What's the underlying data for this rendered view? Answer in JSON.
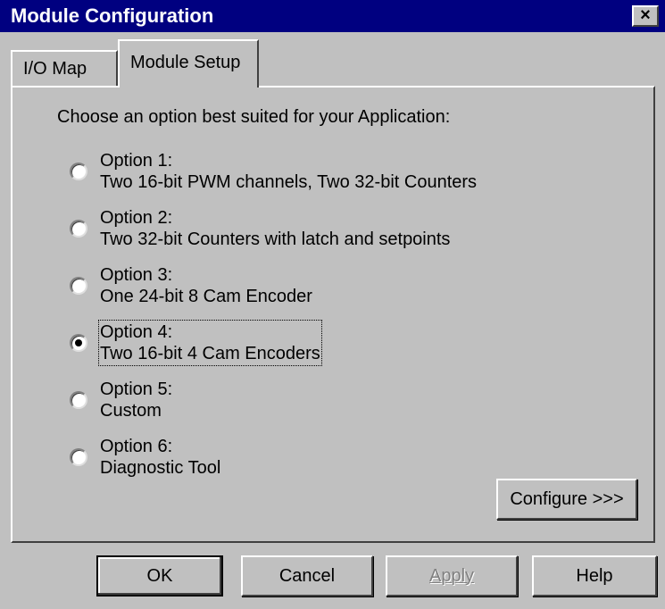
{
  "window": {
    "title": "Module Configuration",
    "close_label": "×"
  },
  "tabs": [
    {
      "label": "I/O Map"
    },
    {
      "label": "Module Setup"
    }
  ],
  "setup": {
    "prompt": "Choose an option best suited for your Application:",
    "options": [
      {
        "title": "Option 1:",
        "description": "Two 16-bit PWM channels, Two 32-bit Counters",
        "selected": false
      },
      {
        "title": "Option 2:",
        "description": "Two 32-bit Counters with latch and setpoints",
        "selected": false
      },
      {
        "title": "Option 3:",
        "description": "One 24-bit 8 Cam Encoder",
        "selected": false
      },
      {
        "title": "Option 4:",
        "description": "Two 16-bit 4 Cam Encoders",
        "selected": true
      },
      {
        "title": "Option 5:",
        "description": "Custom",
        "selected": false
      },
      {
        "title": "Option 6:",
        "description": "Diagnostic Tool",
        "selected": false
      }
    ],
    "configure_label": "Configure >>>"
  },
  "buttons": {
    "ok": "OK",
    "cancel": "Cancel",
    "apply": "Apply",
    "help": "Help"
  }
}
